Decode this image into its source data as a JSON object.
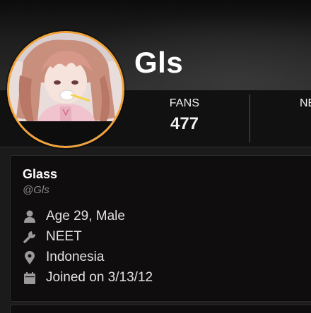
{
  "header": {
    "display_name": "Gls"
  },
  "stats": {
    "fans_label": "FANS",
    "fans_value": "477",
    "next_label_partial": "NE"
  },
  "profile": {
    "name": "Glass",
    "handle": "@Gls",
    "details": [
      {
        "icon": "user-icon",
        "text": "Age 29, Male"
      },
      {
        "icon": "wrench-icon",
        "text": "NEET"
      },
      {
        "icon": "location-pin-icon",
        "text": "Indonesia"
      },
      {
        "icon": "calendar-icon",
        "text": "Joined on 3/13/12"
      }
    ]
  },
  "colors": {
    "avatar_ring": "#f2a33a",
    "background": "#1b1b1b",
    "card_background": "#0f0d0d",
    "text_primary": "#ffffff",
    "text_muted": "#8a8a8a",
    "icon_color": "#9a9a9a"
  }
}
